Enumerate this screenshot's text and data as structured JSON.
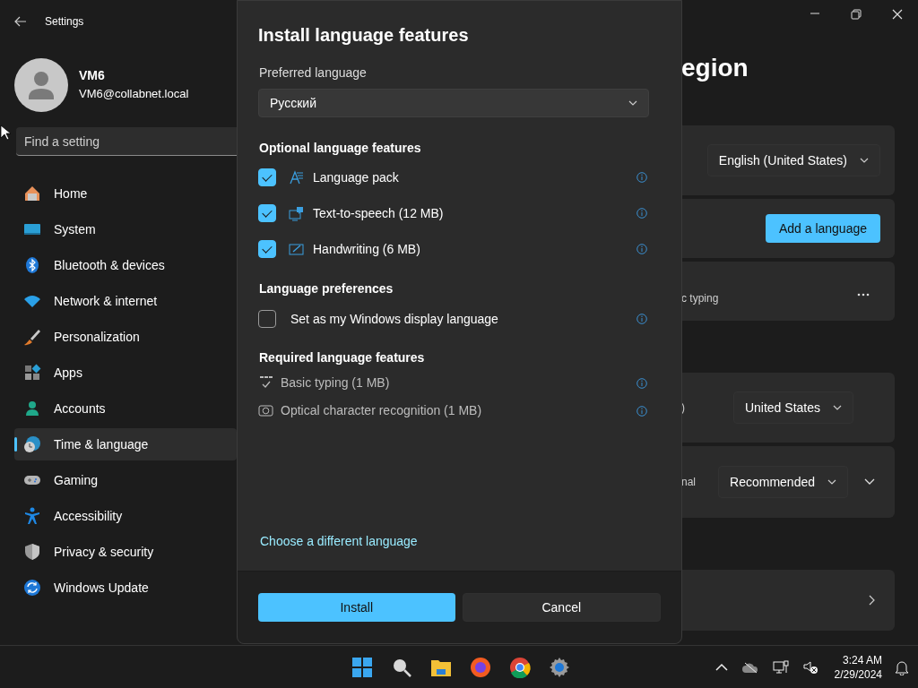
{
  "window": {
    "title": "Settings"
  },
  "account": {
    "name": "VM6",
    "email": "VM6@collabnet.local"
  },
  "search": {
    "placeholder": "Find a setting"
  },
  "nav": [
    {
      "label": "Home",
      "selected": false
    },
    {
      "label": "System",
      "selected": false
    },
    {
      "label": "Bluetooth & devices",
      "selected": false
    },
    {
      "label": "Network & internet",
      "selected": false
    },
    {
      "label": "Personalization",
      "selected": false
    },
    {
      "label": "Apps",
      "selected": false
    },
    {
      "label": "Accounts",
      "selected": false
    },
    {
      "label": "Time & language",
      "selected": true
    },
    {
      "label": "Gaming",
      "selected": false
    },
    {
      "label": "Accessibility",
      "selected": false
    },
    {
      "label": "Privacy & security",
      "selected": false
    },
    {
      "label": "Windows Update",
      "selected": false
    }
  ],
  "page": {
    "heading": "egion",
    "card_groups": [
      {
        "cards": [
          {
            "kind": "dropdown",
            "value": "English (United States)"
          },
          {
            "kind": "button",
            "label": "Add a language"
          },
          {
            "kind": "language",
            "text": "c typing"
          }
        ]
      },
      {
        "cards": [
          {
            "kind": "dropdown",
            "fragment": ")",
            "value": "United States"
          },
          {
            "kind": "dropdown-expand",
            "fragment": "nal",
            "value": "Recommended"
          }
        ]
      },
      {
        "cards": [
          {
            "kind": "link"
          }
        ]
      }
    ]
  },
  "dialog": {
    "title": "Install language features",
    "preferred_label": "Preferred language",
    "preferred_value": "Русский",
    "optional_heading": "Optional language features",
    "optional": [
      {
        "label": "Language pack",
        "checked": true
      },
      {
        "label": "Text-to-speech (12 MB)",
        "checked": true
      },
      {
        "label": "Handwriting (6 MB)",
        "checked": true
      }
    ],
    "preferences_heading": "Language preferences",
    "preferences": [
      {
        "label": "Set as my Windows display language",
        "checked": false
      }
    ],
    "required_heading": "Required language features",
    "required": [
      {
        "label": "Basic typing (1 MB)"
      },
      {
        "label": "Optical character recognition (1 MB)"
      }
    ],
    "link": "Choose a different language",
    "primary": "Install",
    "secondary": "Cancel"
  },
  "taskbar": {
    "time": "3:24 AM",
    "date": "2/29/2024"
  }
}
